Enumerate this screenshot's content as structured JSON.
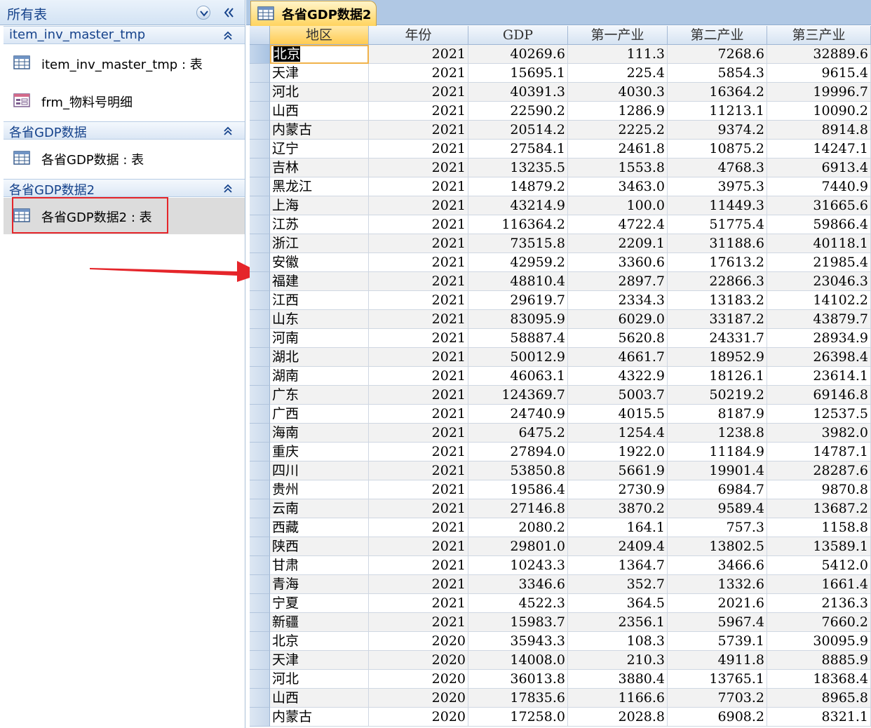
{
  "nav": {
    "title": "所有表",
    "groups": [
      {
        "label": "item_inv_master_tmp",
        "items": [
          {
            "label": "item_inv_master_tmp : 表",
            "icon": "table-icon"
          },
          {
            "label": "frm_物料号明细",
            "icon": "form-icon"
          }
        ]
      },
      {
        "label": "各省GDP数据",
        "items": [
          {
            "label": "各省GDP数据 : 表",
            "icon": "table-icon"
          }
        ]
      },
      {
        "label": "各省GDP数据2",
        "items": [
          {
            "label": "各省GDP数据2 : 表",
            "icon": "table-icon"
          }
        ]
      }
    ]
  },
  "tab": {
    "label": "各省GDP数据2",
    "icon": "table-icon"
  },
  "columns": [
    "地区",
    "年份",
    "GDP",
    "第一产业",
    "第二产业",
    "第三产业"
  ],
  "rows": [
    [
      "北京",
      "2021",
      "40269.6",
      "111.3",
      "7268.6",
      "32889.6"
    ],
    [
      "天津",
      "2021",
      "15695.1",
      "225.4",
      "5854.3",
      "9615.4"
    ],
    [
      "河北",
      "2021",
      "40391.3",
      "4030.3",
      "16364.2",
      "19996.7"
    ],
    [
      "山西",
      "2021",
      "22590.2",
      "1286.9",
      "11213.1",
      "10090.2"
    ],
    [
      "内蒙古",
      "2021",
      "20514.2",
      "2225.2",
      "9374.2",
      "8914.8"
    ],
    [
      "辽宁",
      "2021",
      "27584.1",
      "2461.8",
      "10875.2",
      "14247.1"
    ],
    [
      "吉林",
      "2021",
      "13235.5",
      "1553.8",
      "4768.3",
      "6913.4"
    ],
    [
      "黑龙江",
      "2021",
      "14879.2",
      "3463.0",
      "3975.3",
      "7440.9"
    ],
    [
      "上海",
      "2021",
      "43214.9",
      "100.0",
      "11449.3",
      "31665.6"
    ],
    [
      "江苏",
      "2021",
      "116364.2",
      "4722.4",
      "51775.4",
      "59866.4"
    ],
    [
      "浙江",
      "2021",
      "73515.8",
      "2209.1",
      "31188.6",
      "40118.1"
    ],
    [
      "安徽",
      "2021",
      "42959.2",
      "3360.6",
      "17613.2",
      "21985.4"
    ],
    [
      "福建",
      "2021",
      "48810.4",
      "2897.7",
      "22866.3",
      "23046.3"
    ],
    [
      "江西",
      "2021",
      "29619.7",
      "2334.3",
      "13183.2",
      "14102.2"
    ],
    [
      "山东",
      "2021",
      "83095.9",
      "6029.0",
      "33187.2",
      "43879.7"
    ],
    [
      "河南",
      "2021",
      "58887.4",
      "5620.8",
      "24331.7",
      "28934.9"
    ],
    [
      "湖北",
      "2021",
      "50012.9",
      "4661.7",
      "18952.9",
      "26398.4"
    ],
    [
      "湖南",
      "2021",
      "46063.1",
      "4322.9",
      "18126.1",
      "23614.1"
    ],
    [
      "广东",
      "2021",
      "124369.7",
      "5003.7",
      "50219.2",
      "69146.8"
    ],
    [
      "广西",
      "2021",
      "24740.9",
      "4015.5",
      "8187.9",
      "12537.5"
    ],
    [
      "海南",
      "2021",
      "6475.2",
      "1254.4",
      "1238.8",
      "3982.0"
    ],
    [
      "重庆",
      "2021",
      "27894.0",
      "1922.0",
      "11184.9",
      "14787.1"
    ],
    [
      "四川",
      "2021",
      "53850.8",
      "5661.9",
      "19901.4",
      "28287.6"
    ],
    [
      "贵州",
      "2021",
      "19586.4",
      "2730.9",
      "6984.7",
      "9870.8"
    ],
    [
      "云南",
      "2021",
      "27146.8",
      "3870.2",
      "9589.4",
      "13687.2"
    ],
    [
      "西藏",
      "2021",
      "2080.2",
      "164.1",
      "757.3",
      "1158.8"
    ],
    [
      "陕西",
      "2021",
      "29801.0",
      "2409.4",
      "13802.5",
      "13589.1"
    ],
    [
      "甘肃",
      "2021",
      "10243.3",
      "1364.7",
      "3466.6",
      "5412.0"
    ],
    [
      "青海",
      "2021",
      "3346.6",
      "352.7",
      "1332.6",
      "1661.4"
    ],
    [
      "宁夏",
      "2021",
      "4522.3",
      "364.5",
      "2021.6",
      "2136.3"
    ],
    [
      "新疆",
      "2021",
      "15983.7",
      "2356.1",
      "5967.4",
      "7660.2"
    ],
    [
      "北京",
      "2020",
      "35943.3",
      "108.3",
      "5739.1",
      "30095.9"
    ],
    [
      "天津",
      "2020",
      "14008.0",
      "210.3",
      "4911.8",
      "8885.9"
    ],
    [
      "河北",
      "2020",
      "36013.8",
      "3880.4",
      "13765.1",
      "18368.4"
    ],
    [
      "山西",
      "2020",
      "17835.6",
      "1166.6",
      "7703.2",
      "8965.8"
    ],
    [
      "内蒙古",
      "2020",
      "17258.0",
      "2028.8",
      "6908.2",
      "8321.1"
    ]
  ],
  "colors": {
    "highlight": "#e5252a",
    "tab": "#ffd45f",
    "header": "#d6e3f2"
  }
}
